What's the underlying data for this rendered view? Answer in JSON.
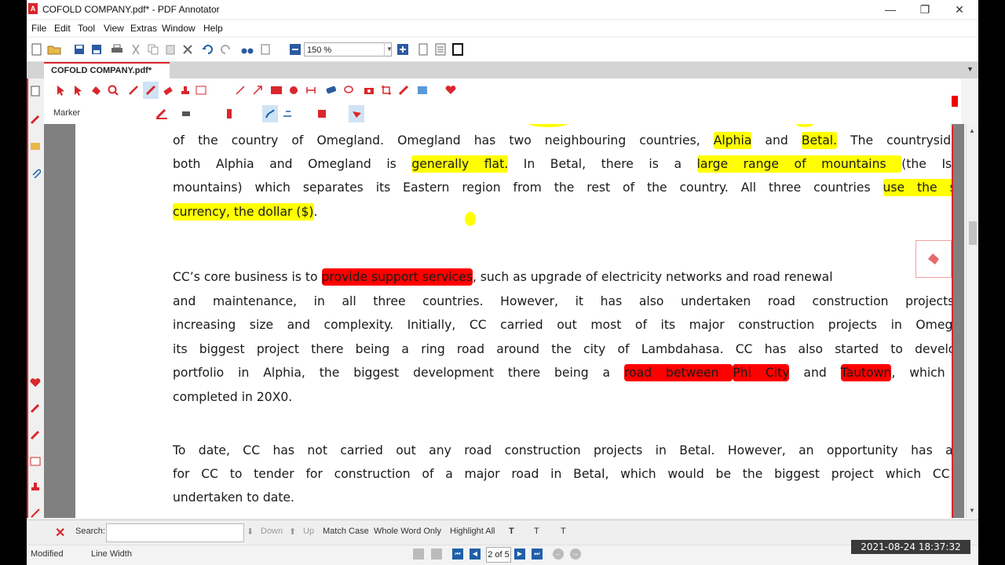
{
  "window": {
    "title": "COFOLD COMPANY.pdf* - PDF Annotator",
    "logo_letter": "A",
    "minimize_glyph": "—",
    "restore_glyph": "❐",
    "close_glyph": "✕"
  },
  "menu": [
    "File",
    "Edit",
    "Tool",
    "View",
    "Extras",
    "Window",
    "Help"
  ],
  "toolbar": {
    "zoom_value": "150 %",
    "zoom_options": [
      "150 %"
    ]
  },
  "tab": {
    "label": "COFOLD COMPANY.pdf*",
    "menu_glyph": "▼"
  },
  "annotation_toolbar": {
    "current_tool": "Marker",
    "accent_color": "#d9262c"
  },
  "document": {
    "para1": {
      "l1": [
        "of the country of Omegland. Omegland has two neighbouring countries, ",
        "Alphia",
        " and ",
        "Betal.",
        " The countryside in"
      ],
      "l2": [
        "both Alphia and Omegland is ",
        "generally flat.",
        " In Betal, there is a ",
        "large range of mountains ",
        "(the Isnardi"
      ],
      "l3": [
        "mountains) which separates its Eastern region from the rest of the country. All three countries ",
        "use the same"
      ],
      "l4": [
        "currency, the dollar ($)",
        "."
      ]
    },
    "para2": {
      "l1": [
        "CC’s core business is to ",
        "provide support services",
        ", such as upgrade of electricity networks and road renewal"
      ],
      "l2": "and maintenance, in all three countries. However, it has also undertaken road construction projects of",
      "l3": "increasing size and complexity. Initially, CC carried out most of its major construction projects in Omegland,",
      "l4": "its biggest project there being a ring road around the city of Lambdahasa. CC has also started to develop a",
      "l5": [
        "portfolio in Alphia, the biggest development there being a ",
        "road between ",
        "Phi City",
        " and ",
        "Tautown",
        ", which was"
      ],
      "l6": "completed in 20X0."
    },
    "para3": {
      "l1": "To date, CC has not carried out any road construction projects in Betal. However, an opportunity has arisen",
      "l2": "for CC to tender for construction of a major road in Betal, which would be the biggest project which CC has",
      "l3": "undertaken to date."
    },
    "highlight_yellow": "#ffff00",
    "highlight_red": "#ff0000"
  },
  "findbar": {
    "close_glyph": "✕",
    "search_label": "Search:",
    "search_value": "",
    "down_label": "Down",
    "up_label": "Up",
    "match_case": "Match Case",
    "whole_word": "Whole Word Only",
    "highlight_all": "Highlight All"
  },
  "statusbar": {
    "state": "Modified",
    "zoom_mode": "Line Width",
    "page_display": "2 of 5"
  },
  "overlay": {
    "timestamp": "2021-08-24  18:37:32"
  }
}
